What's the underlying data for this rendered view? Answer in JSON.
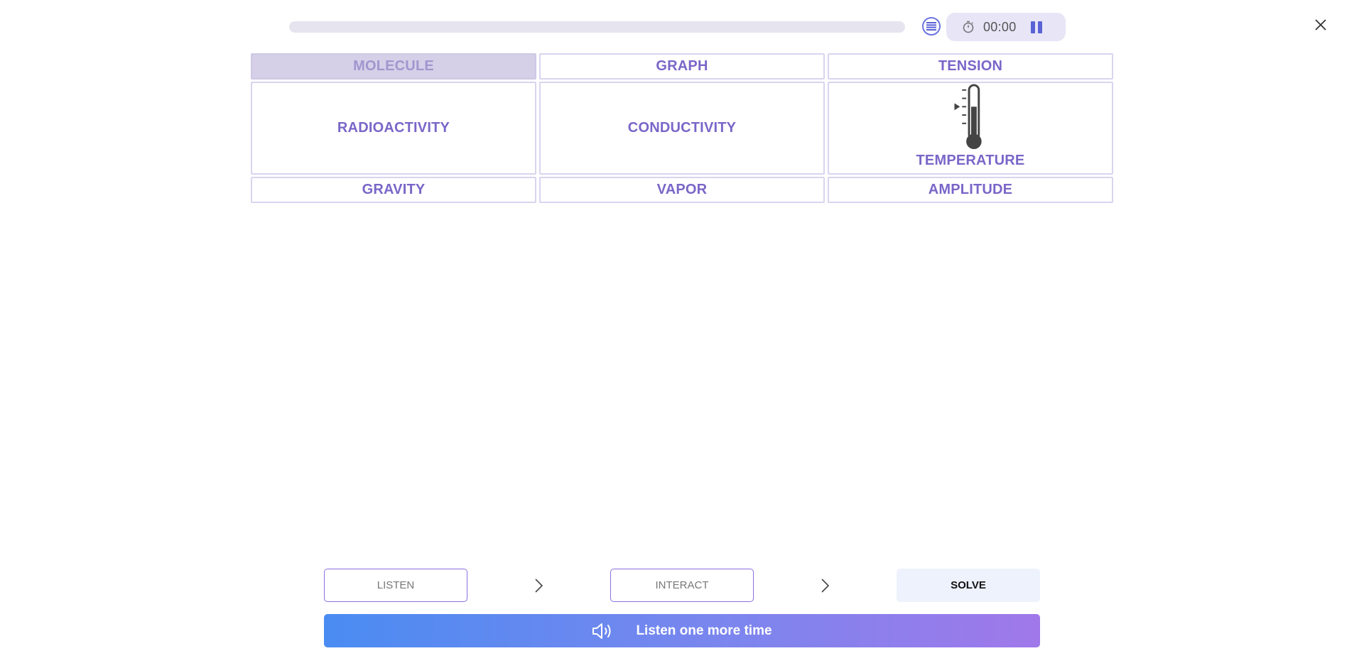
{
  "header": {
    "progress_fraction": 0,
    "timer": "00:00",
    "icons": {
      "list": "list-icon",
      "stopwatch": "stopwatch-icon",
      "pause": "pause-icon",
      "close": "close-icon"
    }
  },
  "grid": {
    "cells": [
      {
        "label": "MOLECULE",
        "selected": true
      },
      {
        "label": "GRAPH"
      },
      {
        "label": "TENSION"
      },
      {
        "label": "RADIOACTIVITY"
      },
      {
        "label": "CONDUCTIVITY"
      },
      {
        "label": "TEMPERATURE",
        "icon": "thermometer-icon"
      },
      {
        "label": "GRAVITY"
      },
      {
        "label": "VAPOR"
      },
      {
        "label": "AMPLITUDE"
      }
    ]
  },
  "steps": {
    "listen": "LISTEN",
    "interact": "INTERACT",
    "solve": "SOLVE"
  },
  "listen_again": {
    "label": "Listen one more time",
    "icon": "speaker-icon"
  },
  "colors": {
    "accent_text": "#7a66c8",
    "selected_bg": "#d5d0e8",
    "gradient_start": "#4a8cf2",
    "gradient_end": "#a078ea"
  }
}
